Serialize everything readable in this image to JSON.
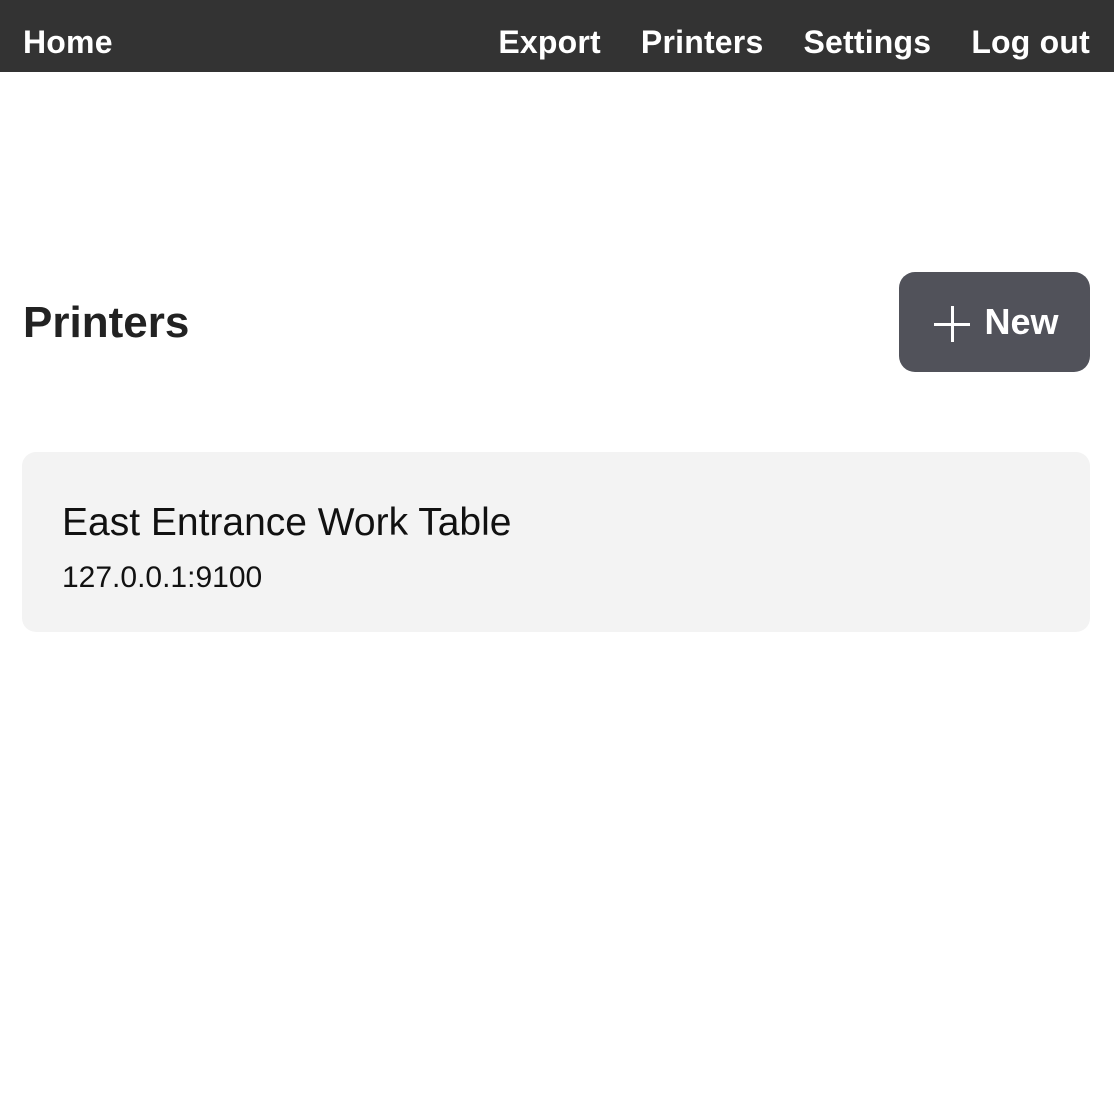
{
  "nav": {
    "home": "Home",
    "items": [
      {
        "label": "Export"
      },
      {
        "label": "Printers"
      },
      {
        "label": "Settings"
      },
      {
        "label": "Log out"
      }
    ]
  },
  "main": {
    "title": "Printers",
    "new_button": {
      "label": "New",
      "icon": "plus-icon"
    }
  },
  "printers": [
    {
      "name": "East Entrance Work Table",
      "address": "127.0.0.1:9100"
    }
  ],
  "colors": {
    "topbar": "#333333",
    "button": "#51525a",
    "card": "#f3f3f3"
  }
}
